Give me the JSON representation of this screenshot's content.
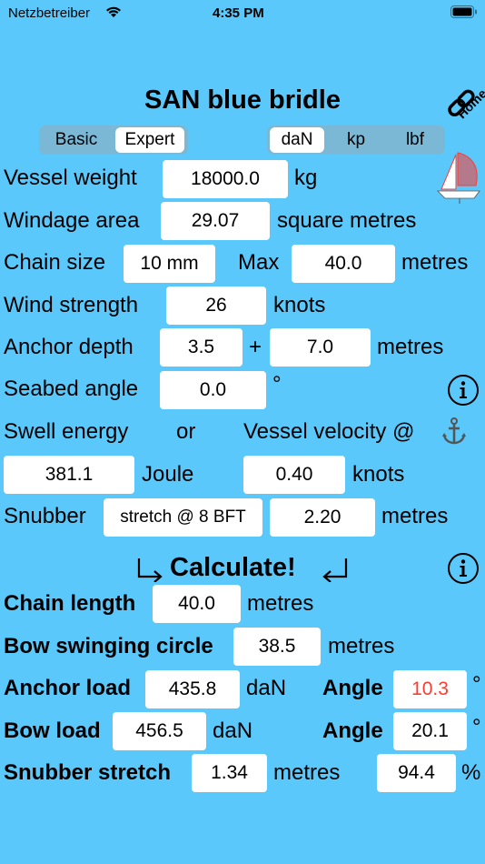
{
  "status": {
    "carrier": "Netzbetreiber",
    "time": "4:35 PM"
  },
  "title": "SAN blue bridle",
  "home_label": "Home",
  "mode_tabs": [
    "Basic",
    "Expert"
  ],
  "unit_tabs": [
    "daN",
    "kp",
    "lbf"
  ],
  "inputs": {
    "vessel_weight": {
      "label": "Vessel weight",
      "value": "18000.0",
      "unit": "kg"
    },
    "windage_area": {
      "label": "Windage area",
      "value": "29.07",
      "unit": "square metres"
    },
    "chain_size": {
      "label": "Chain size",
      "value": "10 mm",
      "max_label": "Max",
      "max_value": "40.0",
      "unit": "metres"
    },
    "wind_strength": {
      "label": "Wind strength",
      "value": "26",
      "unit": "knots"
    },
    "anchor_depth": {
      "label": "Anchor depth",
      "value": "3.5",
      "plus": "+",
      "value2": "7.0",
      "unit": "metres"
    },
    "seabed_angle": {
      "label": "Seabed angle",
      "value": "0.0",
      "unit": "°"
    },
    "swell": {
      "label": "Swell energy",
      "or": "or",
      "velocity_label": "Vessel velocity @",
      "energy_value": "381.1",
      "energy_unit": "Joule",
      "velocity_value": "0.40",
      "velocity_unit": "knots"
    },
    "snubber": {
      "label": "Snubber",
      "type_value": "stretch @ 8 BFT",
      "length_value": "2.20",
      "unit": "metres"
    }
  },
  "calculate_label": "Calculate!",
  "results": {
    "chain_length": {
      "label": "Chain length",
      "value": "40.0",
      "unit": "metres"
    },
    "bow_swinging": {
      "label": "Bow swinging circle",
      "value": "38.5",
      "unit": "metres"
    },
    "anchor_load": {
      "label": "Anchor load",
      "value": "435.8",
      "unit": "daN",
      "angle_label": "Angle",
      "angle_value": "10.3",
      "angle_unit": "°"
    },
    "bow_load": {
      "label": "Bow load",
      "value": "456.5",
      "unit": "daN",
      "angle_label": "Angle",
      "angle_value": "20.1",
      "angle_unit": "°"
    },
    "snubber_stretch": {
      "label": "Snubber stretch",
      "value": "1.34",
      "unit": "metres",
      "percent_value": "94.4",
      "percent_unit": "%"
    }
  },
  "colors": {
    "background": "#5ac8fa",
    "warning": "#ff3b30"
  }
}
